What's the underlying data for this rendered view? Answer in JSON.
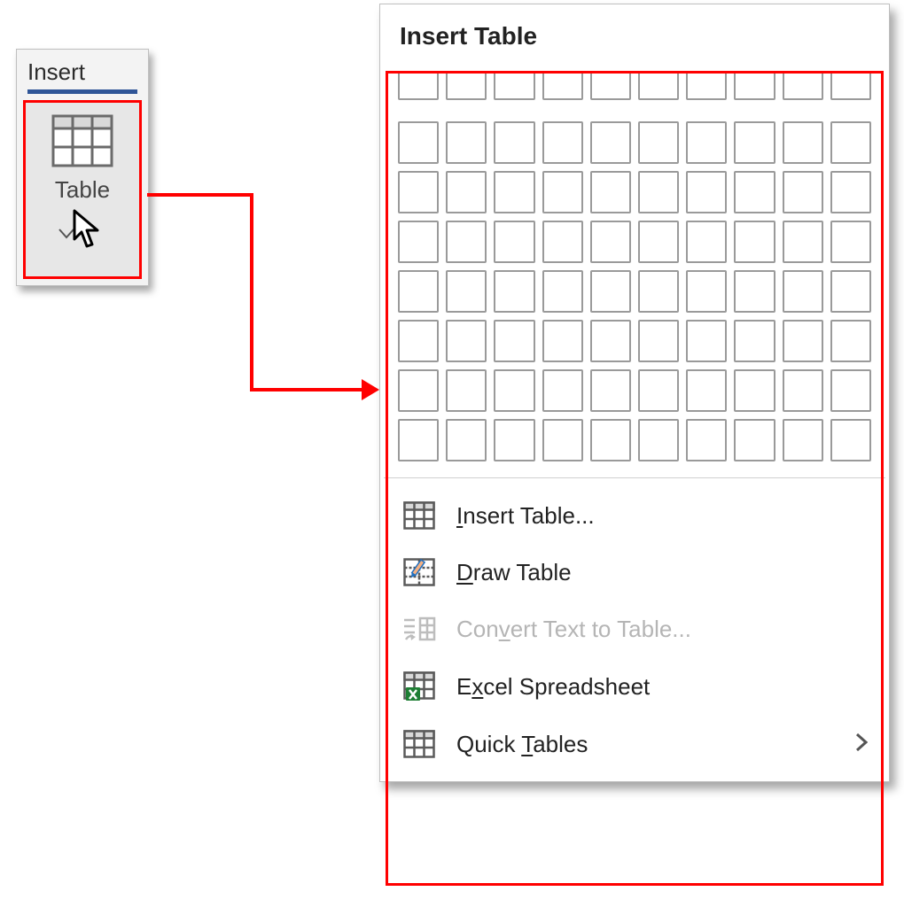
{
  "ribbon": {
    "tab_label": "Insert",
    "table_button_label": "Table"
  },
  "panel": {
    "title": "Insert Table",
    "grid": {
      "cols": 10,
      "rows": 8
    },
    "menu": [
      {
        "icon": "table-icon",
        "pre": "",
        "u": "I",
        "post": "nsert Table...",
        "disabled": false,
        "submenu": false
      },
      {
        "icon": "draw-table-icon",
        "pre": "",
        "u": "D",
        "post": "raw Table",
        "disabled": false,
        "submenu": false
      },
      {
        "icon": "convert-text-icon",
        "pre": "Con",
        "u": "v",
        "post": "ert Text to Table...",
        "disabled": true,
        "submenu": false
      },
      {
        "icon": "excel-icon",
        "pre": "E",
        "u": "x",
        "post": "cel Spreadsheet",
        "disabled": false,
        "submenu": false
      },
      {
        "icon": "quick-tables-icon",
        "pre": "Quick ",
        "u": "T",
        "post": "ables",
        "disabled": false,
        "submenu": true
      }
    ]
  },
  "colors": {
    "highlight": "#ff0000",
    "accent": "#2f5597",
    "excel": "#1e7e34"
  }
}
